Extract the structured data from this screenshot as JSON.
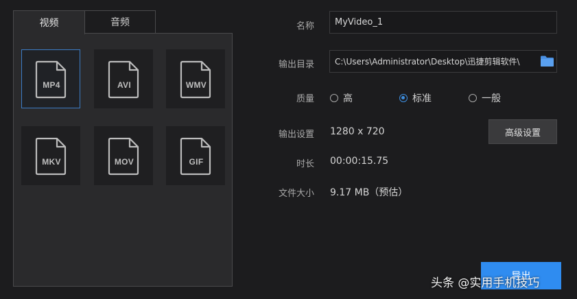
{
  "tabs": [
    {
      "label": "视频"
    },
    {
      "label": "音频"
    }
  ],
  "formats": [
    {
      "label": "MP4"
    },
    {
      "label": "AVI"
    },
    {
      "label": "WMV"
    },
    {
      "label": "MKV"
    },
    {
      "label": "MOV"
    },
    {
      "label": "GIF"
    }
  ],
  "form": {
    "name_label": "名称",
    "name_value": "MyVideo_1",
    "dir_label": "输出目录",
    "dir_value": "C:\\Users\\Administrator\\Desktop\\迅捷剪辑软件\\",
    "quality_label": "质量",
    "quality_options": [
      "高",
      "标准",
      "一般"
    ],
    "quality_selected": "标准",
    "settings_label": "输出设置",
    "settings_value": "1280 x 720",
    "advanced_button": "高级设置",
    "duration_label": "时长",
    "duration_value": "00:00:15.75",
    "size_label": "文件大小",
    "size_value": "9.17 MB（预估）"
  },
  "export_button": "导出",
  "watermark": "头条 @实用手机技巧",
  "colors": {
    "accent": "#2f8cf0",
    "selected_border": "#3d7ec8",
    "folder_icon": "#4a90e2"
  }
}
